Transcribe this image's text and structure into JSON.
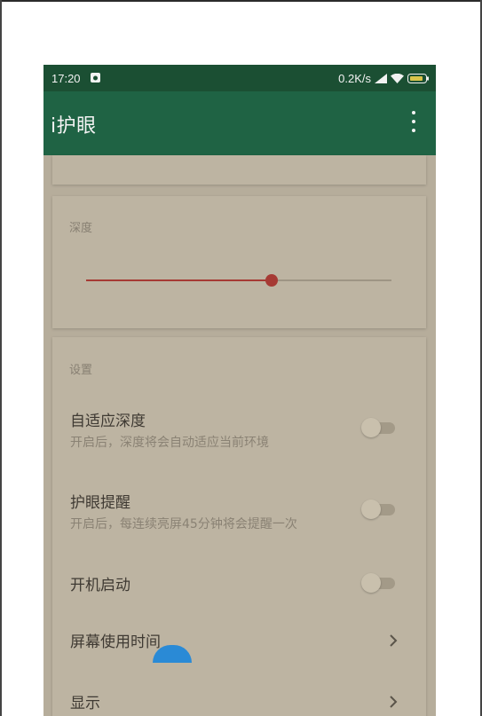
{
  "status_bar": {
    "time": "17:20",
    "network_speed": "0.2K/s",
    "icons": [
      "notification-icon",
      "signal-icon",
      "wifi-icon",
      "battery-icon"
    ]
  },
  "app_bar": {
    "title": "i护眼",
    "menu_icon": "more-vert-icon"
  },
  "depth_card": {
    "label": "深度",
    "slider_value_fraction": 0.61,
    "accent_color": "#a63a34"
  },
  "settings_card": {
    "label": "设置",
    "items": [
      {
        "title": "自适应深度",
        "subtitle": "开启后，深度将会自动适应当前环境",
        "control": "toggle",
        "on": false
      },
      {
        "title": "护眼提醒",
        "subtitle": "开启后，每连续亮屏45分钟将会提醒一次",
        "control": "toggle",
        "on": false
      },
      {
        "title": "开机启动",
        "subtitle": "",
        "control": "toggle",
        "on": false
      },
      {
        "title": "屏幕使用时间",
        "subtitle": "",
        "control": "chevron"
      },
      {
        "title": "显示",
        "subtitle": "",
        "control": "chevron"
      }
    ]
  },
  "colors": {
    "status_bar": "#1b4f33",
    "app_bar": "#1f6344",
    "background": "#b6ad9b",
    "card": "#bdb4a2"
  }
}
